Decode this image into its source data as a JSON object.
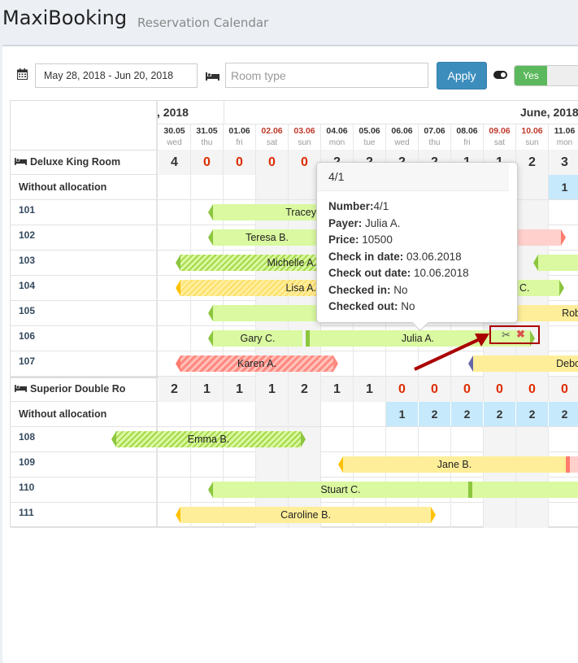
{
  "header": {
    "brand": "MaxiBooking",
    "subtitle": "Reservation Calendar"
  },
  "toolbar": {
    "date_range": "May 28, 2018 - Jun 20, 2018",
    "room_type_placeholder": "Room type",
    "apply_label": "Apply",
    "switch_on_label": "Yes"
  },
  "months": {
    "may": ", 2018",
    "june": "June, 2018"
  },
  "dates": [
    {
      "d": "30.05",
      "w": "wed",
      "weekend": false
    },
    {
      "d": "31.05",
      "w": "thu",
      "weekend": false
    },
    {
      "d": "01.06",
      "w": "fri",
      "weekend": false
    },
    {
      "d": "02.06",
      "w": "sat",
      "weekend": true
    },
    {
      "d": "03.06",
      "w": "sun",
      "weekend": true
    },
    {
      "d": "04.06",
      "w": "mon",
      "weekend": false
    },
    {
      "d": "05.06",
      "w": "tue",
      "weekend": false
    },
    {
      "d": "06.06",
      "w": "wed",
      "weekend": false
    },
    {
      "d": "07.06",
      "w": "thu",
      "weekend": false
    },
    {
      "d": "08.06",
      "w": "fri",
      "weekend": false
    },
    {
      "d": "09.06",
      "w": "sat",
      "weekend": true
    },
    {
      "d": "10.06",
      "w": "sun",
      "weekend": true
    },
    {
      "d": "11.06",
      "w": "mon",
      "weekend": false
    }
  ],
  "room_types": [
    {
      "name": "Deluxe King Room",
      "counts": [
        4,
        0,
        0,
        0,
        0,
        2,
        2,
        2,
        2,
        1,
        1,
        2,
        3
      ],
      "without_allocation_label": "Without allocation",
      "without_allocation": [
        null,
        null,
        null,
        null,
        null,
        null,
        null,
        null,
        null,
        null,
        null,
        null,
        1
      ],
      "rooms": [
        "101",
        "102",
        "103",
        "104",
        "105",
        "106",
        "107"
      ]
    },
    {
      "name": "Superior Double Ro",
      "counts": [
        2,
        1,
        1,
        1,
        2,
        1,
        1,
        0,
        0,
        0,
        0,
        0,
        0
      ],
      "without_allocation_label": "Without allocation",
      "without_allocation": [
        null,
        null,
        null,
        null,
        null,
        null,
        null,
        1,
        2,
        2,
        2,
        2,
        2
      ],
      "rooms": [
        "108",
        "109",
        "110",
        "111"
      ]
    }
  ],
  "bookings": {
    "tracey": "Tracey",
    "teresa": "Teresa B.",
    "michelle": "Michelle A.",
    "lisa": "Lisa A.",
    "c104": "C.",
    "rob": "Rob",
    "gary": "Gary C.",
    "julia": "Julia A.",
    "karen": "Karen A.",
    "debo": "Debo",
    "emma": "Emma B.",
    "jane": "Jane B.",
    "stuart": "Stuart C.",
    "caroline": "Caroline B."
  },
  "tooltip": {
    "title": "4/1",
    "number_label": "Number:",
    "number": "4/1",
    "payer_label": "Payer:",
    "payer": " Julia A.",
    "price_label": "Price:",
    "price": " 10500",
    "checkin_label": "Check in date:",
    "checkin": " 03.06.2018",
    "checkout_label": "Check out date:",
    "checkout": " 10.06.2018",
    "checkedin_label": "Checked in:",
    "checkedin": " No",
    "checkedout_label": "Checked out:",
    "checkedout": " No"
  },
  "colors": {
    "accent": "#3c8dbc",
    "success": "#5cb85c",
    "danger": "#dd2c00",
    "highlight": "#aa0000"
  }
}
